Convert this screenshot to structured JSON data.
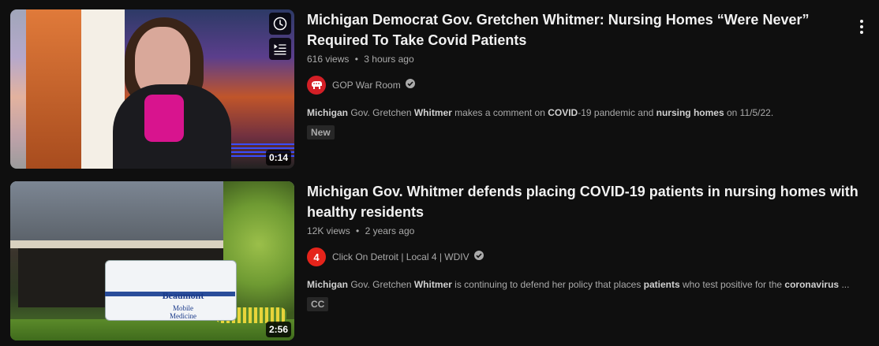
{
  "colors": {
    "background": "#0f0f0f",
    "title": "#f1f1f1",
    "secondary": "#aaaaaa",
    "badge_bg": "#272727"
  },
  "results": [
    {
      "title": "Michigan Democrat Gov. Gretchen Whitmer: Nursing Homes “Were Never” Required To Take Covid Patients",
      "views": "616 views",
      "age": "3 hours ago",
      "channel": "GOP War Room",
      "channel_icon": "republican-elephant-icon",
      "verified": true,
      "description_parts": [
        {
          "text": "Michigan",
          "bold": true
        },
        {
          "text": " Gov. Gretchen ",
          "bold": false
        },
        {
          "text": "Whitmer",
          "bold": true
        },
        {
          "text": " makes a comment on ",
          "bold": false
        },
        {
          "text": "COVID",
          "bold": true
        },
        {
          "text": "-19 pandemic and ",
          "bold": false
        },
        {
          "text": "nursing homes",
          "bold": true
        },
        {
          "text": " on 11/5/22.",
          "bold": false
        }
      ],
      "badge": "New",
      "duration": "0:14",
      "overlay_icons": [
        "watch-later-icon",
        "add-to-queue-icon"
      ]
    },
    {
      "title": "Michigan Gov. Whitmer defends placing COVID-19 patients in nursing homes with healthy residents",
      "views": "12K views",
      "age": "2 years ago",
      "channel": "Click On Detroit | Local 4 | WDIV",
      "channel_icon": "local-4-icon",
      "channel_avatar_text": "4",
      "verified": true,
      "description_parts": [
        {
          "text": "Michigan",
          "bold": true
        },
        {
          "text": " Gov. Gretchen ",
          "bold": false
        },
        {
          "text": "Whitmer",
          "bold": true
        },
        {
          "text": " is continuing to defend her policy that places ",
          "bold": false
        },
        {
          "text": "patients",
          "bold": true
        },
        {
          "text": " who test positive for the ",
          "bold": false
        },
        {
          "text": "coronavirus",
          "bold": true
        },
        {
          "text": " ...",
          "bold": false
        }
      ],
      "badge": "CC",
      "duration": "2:56",
      "thumbnail_text": {
        "line1": "Beaumont",
        "line2": "Mobile Medicine"
      }
    }
  ],
  "meta_separator": "•"
}
